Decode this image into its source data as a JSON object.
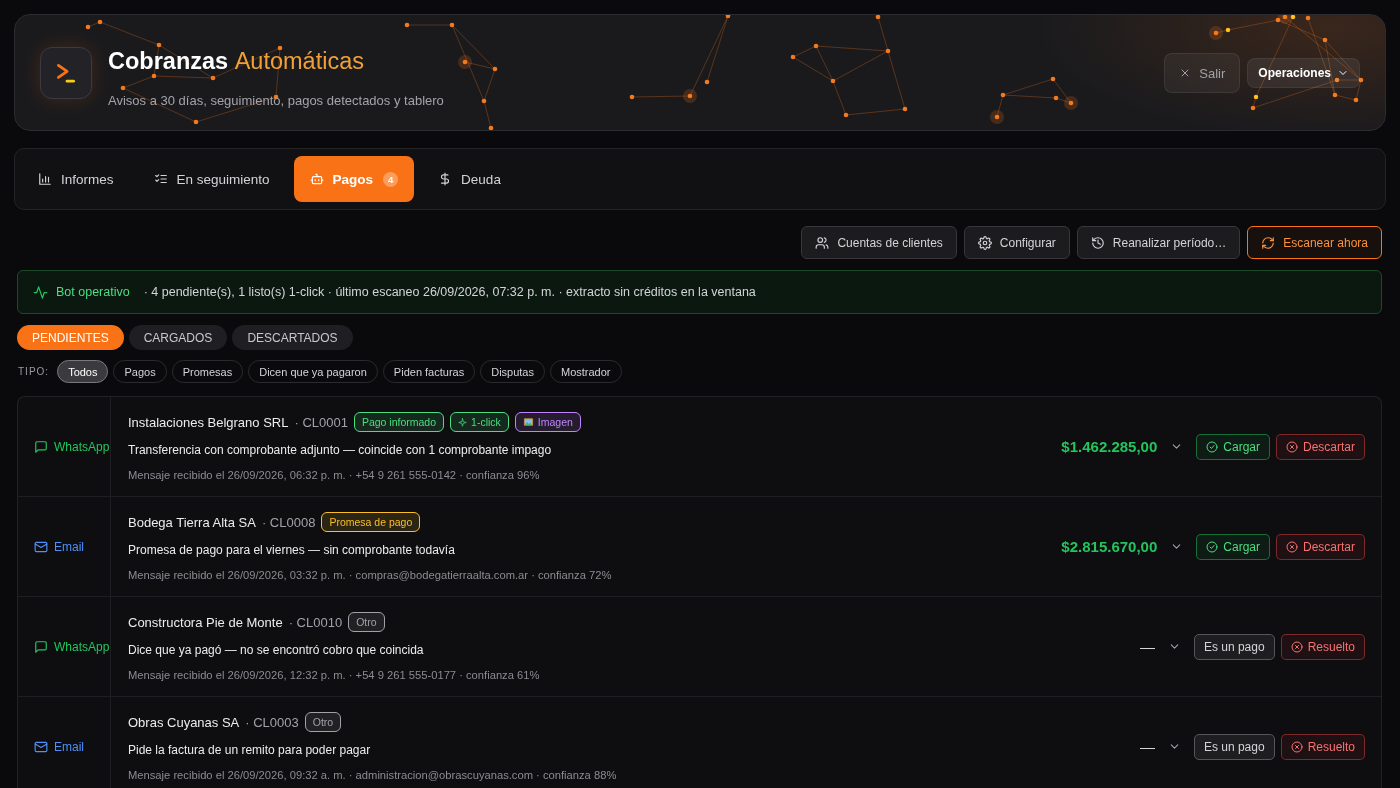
{
  "header": {
    "title": {
      "text": "Cobranzas",
      "accent": "Automáticas"
    },
    "subtitle": "Avisos a 30 días, seguimiento, pagos detectados y tablero",
    "exit_button": "Salir",
    "menu_button": "Operaciones"
  },
  "tabs": [
    {
      "label": "Informes",
      "selected": false
    },
    {
      "label": "En seguimiento",
      "selected": false
    },
    {
      "label": "Pagos",
      "selected": true,
      "count": "4"
    },
    {
      "label": "Deuda",
      "selected": false
    }
  ],
  "toolbar": [
    {
      "label": "Cuentas de clientes",
      "kind": "default"
    },
    {
      "label": "Configurar",
      "kind": "default"
    },
    {
      "label": "Reanalizar período…",
      "kind": "default"
    },
    {
      "label": "Escanear ahora",
      "kind": "primary"
    }
  ],
  "status_banner": {
    "label": "Bot operativo",
    "detail": "· 4 pendiente(s), 1 listo(s) 1-click · último escaneo 26/09/2026, 07:32 p. m. · extracto sin créditos en la ventana"
  },
  "status_filters": [
    {
      "label": "PENDIENTES",
      "selected": true
    },
    {
      "label": "CARGADOS",
      "selected": false
    },
    {
      "label": "DESCARTADOS",
      "selected": false
    }
  ],
  "type_filter": {
    "label": "TIPO:",
    "options": [
      {
        "label": "Todos",
        "selected": true
      },
      {
        "label": "Pagos",
        "selected": false
      },
      {
        "label": "Promesas",
        "selected": false
      },
      {
        "label": "Dicen que ya pagaron",
        "selected": false
      },
      {
        "label": "Piden facturas",
        "selected": false
      },
      {
        "label": "Disputas",
        "selected": false
      },
      {
        "label": "Mostrador",
        "selected": false
      }
    ]
  },
  "rows": [
    {
      "channel": {
        "kind": "whatsapp",
        "label": "WhatsApp"
      },
      "name": "Instalaciones Belgrano SRL",
      "code": "· CL0001",
      "badges": [
        {
          "label": "Pago informado",
          "kind": "plain",
          "color": "#4ade80"
        },
        {
          "label": "1-click",
          "kind": "oneclick",
          "color": "#4ade80"
        },
        {
          "label": "Imagen",
          "kind": "image",
          "color": "#c084fc"
        }
      ],
      "summary": "Transferencia con comprobante adjunto — coincide con 1 comprobante impago",
      "meta": "Mensaje recibido el 26/09/2026, 06:32 p. m. · +54 9 261 555-0142 · confianza 96%",
      "amount": {
        "text": "$1.462.285,00",
        "detected": true
      },
      "expanded": false,
      "actions": [
        {
          "label": "Cargar",
          "kind": "confirm"
        },
        {
          "label": "Descartar",
          "kind": "discard"
        }
      ]
    },
    {
      "channel": {
        "kind": "email",
        "label": "Email"
      },
      "name": "Bodega Tierra Alta SA",
      "code": "· CL0008",
      "badges": [
        {
          "label": "Promesa de pago",
          "kind": "plain",
          "color": "#fbbf24"
        }
      ],
      "summary": "Promesa de pago para el viernes — sin comprobante todavía",
      "meta": "Mensaje recibido el 26/09/2026, 03:32 p. m. · compras@bodegatierraalta.com.ar · confianza 72%",
      "amount": {
        "text": "$2.815.670,00",
        "detected": true
      },
      "expanded": false,
      "actions": [
        {
          "label": "Cargar",
          "kind": "confirm"
        },
        {
          "label": "Descartar",
          "kind": "discard"
        }
      ]
    },
    {
      "channel": {
        "kind": "whatsapp",
        "label": "WhatsApp"
      },
      "name": "Constructora Pie de Monte",
      "code": "· CL0010",
      "badges": [
        {
          "label": "Otro",
          "kind": "plain",
          "color": "#a1a1aa"
        }
      ],
      "summary": "Dice que ya pagó — no se encontró cobro que coincida",
      "meta": "Mensaje recibido el 26/09/2026, 12:32 p. m. · +54 9 261 555-0177 · confianza 61%",
      "amount": {
        "text": "—",
        "detected": false
      },
      "expanded": false,
      "actions": [
        {
          "label": "Es un pago",
          "kind": "neutral"
        },
        {
          "label": "Resuelto",
          "kind": "discard"
        }
      ]
    },
    {
      "channel": {
        "kind": "email",
        "label": "Email"
      },
      "name": "Obras Cuyanas SA",
      "code": "· CL0003",
      "badges": [
        {
          "label": "Otro",
          "kind": "plain",
          "color": "#a1a1aa"
        }
      ],
      "summary": "Pide la factura de un remito para poder pagar",
      "meta": "Mensaje recibido el 26/09/2026, 09:32 a. m. · administracion@obrascuyanas.com · confianza 88%",
      "amount": {
        "text": "—",
        "detected": false
      },
      "expanded": false,
      "actions": [
        {
          "label": "Es un pago",
          "kind": "neutral"
        },
        {
          "label": "Resuelto",
          "kind": "discard"
        }
      ]
    }
  ]
}
